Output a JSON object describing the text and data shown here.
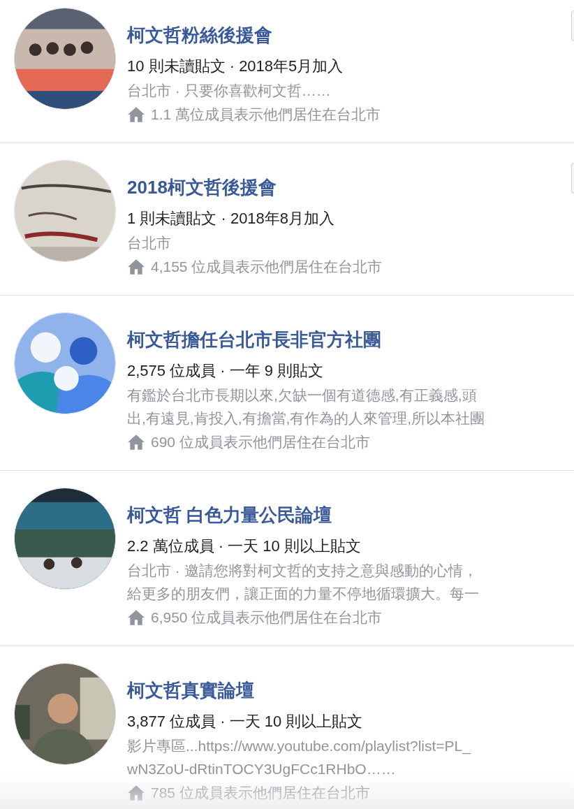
{
  "groups": [
    {
      "name": "柯文哲粉絲後援會",
      "meta": "10 則未讀貼文 · 2018年5月加入",
      "description": [
        "台北市 · 只要你喜歡柯文哲……"
      ],
      "residents": "1.1 萬位成員表示他們居住在台北市",
      "menu_button": true,
      "avatar": {
        "kind": "picture"
      }
    },
    {
      "name": "2018柯文哲後援會",
      "meta": "1 則未讀貼文 · 2018年8月加入",
      "description": [
        "台北市"
      ],
      "residents": "4,155 位成員表示他們居住在台北市",
      "menu_button": true,
      "avatar": {
        "kind": "picture"
      }
    },
    {
      "name": "柯文哲擔任台北市長非官方社團",
      "meta": "2,575 位成員 · 一年 9 則貼文",
      "description": [
        "有鑑於台北市長期以來,欠缺一個有道德感,有正義感,頭",
        "出,有遠見,肯投入,有擔當,有作為的人來管理,所以本社團"
      ],
      "residents": "690 位成員表示他們居住在台北市",
      "menu_button": false,
      "avatar": {
        "kind": "picture"
      }
    },
    {
      "name": "柯文哲 白色力量公民論壇",
      "meta": "2.2 萬位成員 · 一天 10 則以上貼文",
      "description": [
        "台北市 · 邀請您將對柯文哲的支持之意與感動的心情，",
        "給更多的朋友們，讓正面的力量不停地循環擴大。每一"
      ],
      "residents": "6,950 位成員表示他們居住在台北市",
      "menu_button": false,
      "avatar": {
        "kind": "picture"
      }
    },
    {
      "name": "柯文哲真實論壇",
      "meta": "3,877 位成員 · 一天 10 則以上貼文",
      "description": [
        "影片專區...https://www.youtube.com/playlist?list=PL_",
        "wN3ZoU-dRtinTOCY3UgFCc1RHbO……"
      ],
      "residents": "785 位成員表示他們居住在台北市",
      "menu_button": false,
      "avatar": {
        "kind": "picture"
      }
    }
  ]
}
